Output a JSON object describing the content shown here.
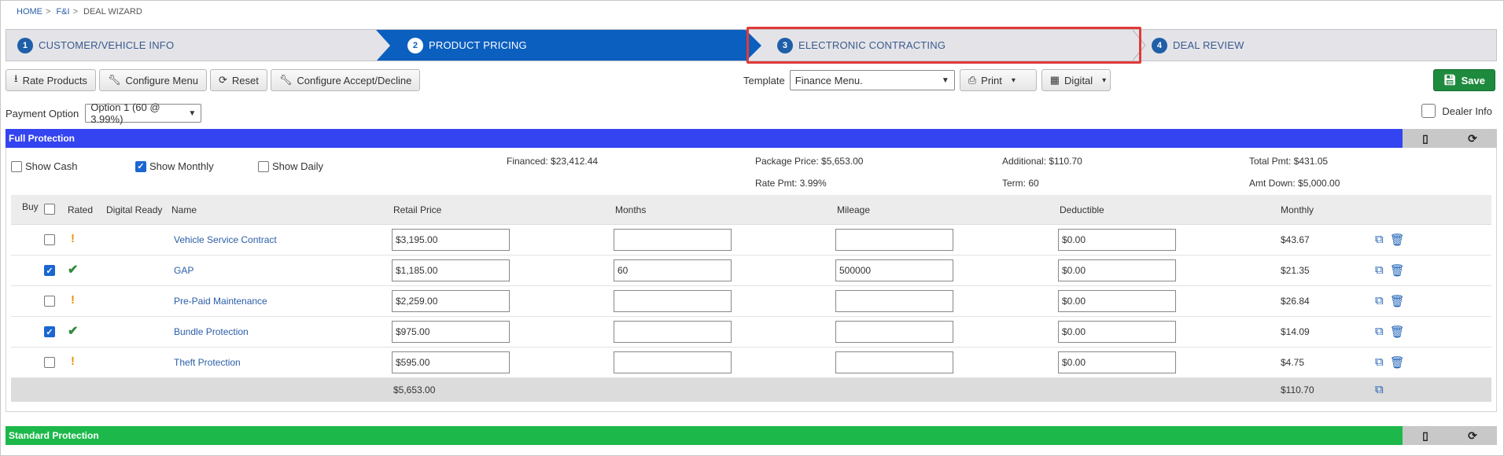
{
  "breadcrumb": [
    "HOME",
    "F&I",
    "DEAL WIZARD"
  ],
  "breadcrumb_sep": ">",
  "wizard": {
    "steps": [
      {
        "num": "1",
        "label": "CUSTOMER/VEHICLE INFO"
      },
      {
        "num": "2",
        "label": "PRODUCT PRICING"
      },
      {
        "num": "3",
        "label": "ELECTRONIC CONTRACTING"
      },
      {
        "num": "4",
        "label": "DEAL REVIEW"
      }
    ],
    "active_step": 2,
    "highlighted_step": 3
  },
  "toolbar": {
    "rate_products": "Rate Products",
    "configure_menu": "Configure Menu",
    "reset": "Reset",
    "configure_accept_decline": "Configure Accept/Decline",
    "template_label": "Template",
    "template_value": "Finance Menu.",
    "print": "Print",
    "digital": "Digital",
    "save": "Save"
  },
  "payment": {
    "label": "Payment Option",
    "value": "Option 1 (60 @ 3.99%)"
  },
  "dealer_info": {
    "label": "Dealer Info",
    "checked": false
  },
  "full_protection": {
    "title": "Full Protection",
    "color": "#3344f0",
    "options": {
      "show_cash": "Show Cash",
      "show_monthly": "Show Monthly",
      "show_daily": "Show Daily"
    },
    "summary": {
      "financed": "Financed: $23,412.44",
      "package_price": "Package Price: $5,653.00",
      "rate_pmt": "Rate Pmt: 3.99%",
      "additional": "Additional: $110.70",
      "term": "Term: 60",
      "total_pmt": "Total Pmt: $431.05",
      "amt_down": "Amt Down: $5,000.00"
    },
    "columns": {
      "buy": "Buy",
      "rated": "Rated",
      "digital_ready": "Digital Ready",
      "name": "Name",
      "retail_price": "Retail Price",
      "months": "Months",
      "mileage": "Mileage",
      "deductible": "Deductible",
      "monthly": "Monthly"
    },
    "rows": [
      {
        "name": "Vehicle Service Contract",
        "buy": false,
        "rated": "warning",
        "retail": "$3,195.00",
        "months": "",
        "mileage": "",
        "deductible": "$0.00",
        "monthly": "$43.67"
      },
      {
        "name": "GAP",
        "buy": true,
        "rated": "ok",
        "retail": "$1,185.00",
        "months": "60",
        "mileage": "500000",
        "deductible": "$0.00",
        "monthly": "$21.35"
      },
      {
        "name": "Pre-Paid Maintenance",
        "buy": false,
        "rated": "warning",
        "retail": "$2,259.00",
        "months": "",
        "mileage": "",
        "deductible": "$0.00",
        "monthly": "$26.84"
      },
      {
        "name": "Bundle Protection",
        "buy": true,
        "rated": "ok",
        "retail": "$975.00",
        "months": "",
        "mileage": "",
        "deductible": "$0.00",
        "monthly": "$14.09"
      },
      {
        "name": "Theft Protection",
        "buy": false,
        "rated": "warning",
        "retail": "$595.00",
        "months": "",
        "mileage": "",
        "deductible": "$0.00",
        "monthly": "$4.75"
      }
    ],
    "footer": {
      "retail_total": "$5,653.00",
      "monthly_total": "$110.70"
    }
  },
  "standard_protection": {
    "title": "Standard Protection",
    "color": "#1db84a"
  },
  "colors": {
    "active_step": "#0b5fbf",
    "highlight": "#e03a3a",
    "save": "#1e8a3e",
    "link": "#2a5da8"
  }
}
